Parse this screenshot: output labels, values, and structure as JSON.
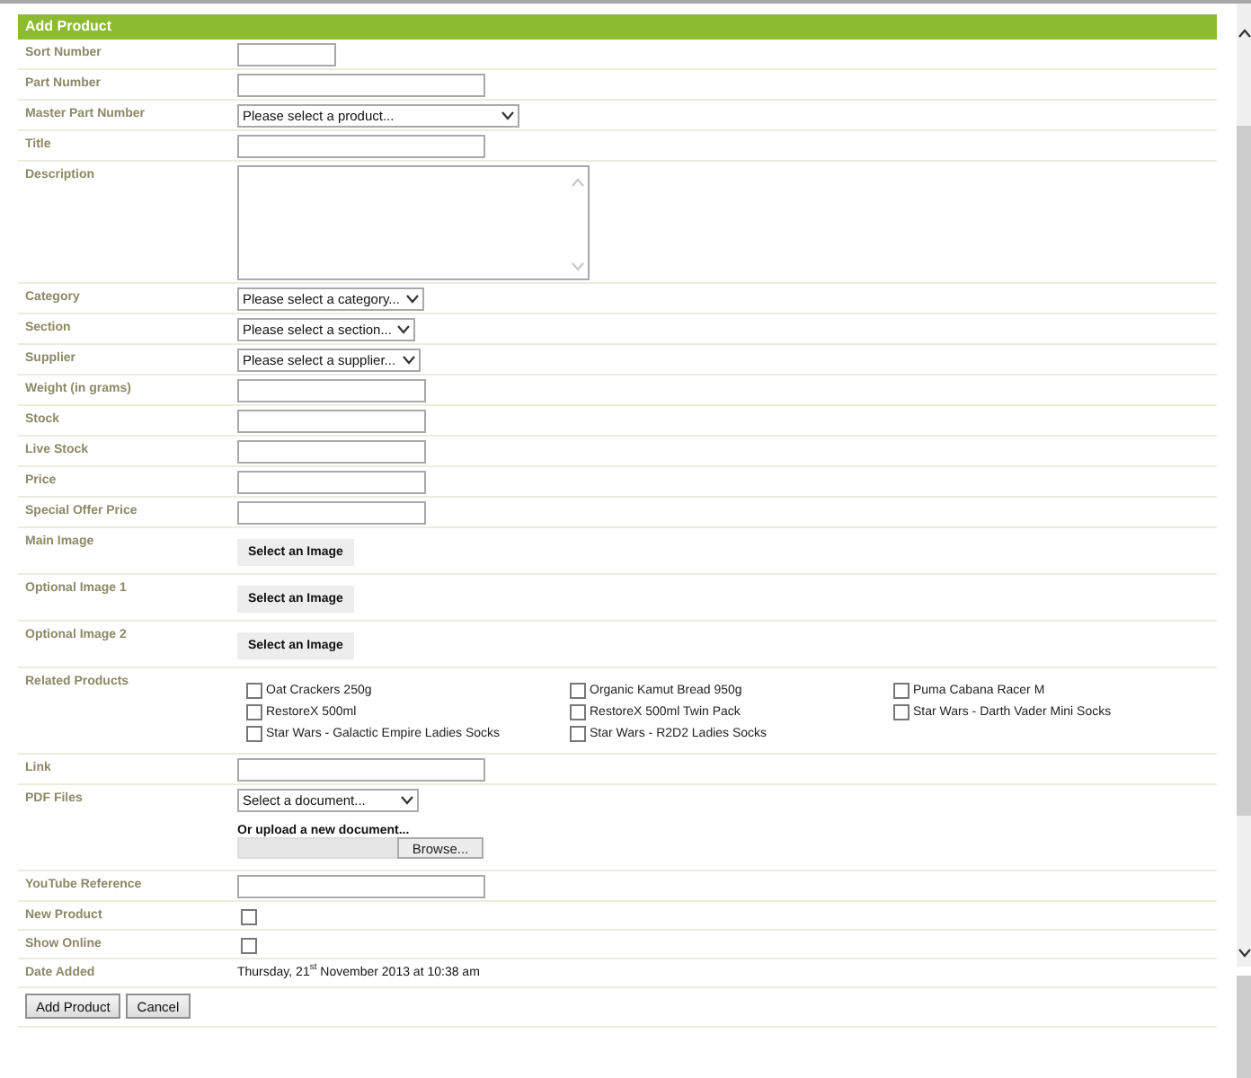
{
  "header": {
    "title": "Add Product"
  },
  "fields": [
    {
      "kind": "text",
      "label": "Sort Number"
    },
    {
      "kind": "text",
      "label": "Part Number"
    },
    {
      "kind": "select",
      "label": "Master Part Number",
      "value": "Please select a product..."
    },
    {
      "kind": "text",
      "label": "Title"
    },
    {
      "kind": "textarea",
      "label": "Description"
    },
    {
      "kind": "select",
      "label": "Category",
      "value": "Please select a category..."
    },
    {
      "kind": "select",
      "label": "Section",
      "value": "Please select a section..."
    },
    {
      "kind": "select",
      "label": "Supplier",
      "value": "Please select a supplier..."
    },
    {
      "kind": "text",
      "label": "Weight (in grams)"
    },
    {
      "kind": "text",
      "label": "Stock"
    },
    {
      "kind": "text",
      "label": "Live Stock"
    },
    {
      "kind": "text",
      "label": "Price"
    },
    {
      "kind": "text",
      "label": "Special Offer Price"
    },
    {
      "kind": "image",
      "label": "Main Image",
      "button": "Select an Image"
    },
    {
      "kind": "image",
      "label": "Optional Image 1",
      "button": "Select an Image"
    },
    {
      "kind": "image",
      "label": "Optional Image 2",
      "button": "Select an Image"
    },
    {
      "kind": "related",
      "label": "Related Products",
      "items": [
        {
          "label": "Oat Crackers 250g",
          "checked": false
        },
        {
          "label": "Organic Kamut Bread 950g",
          "checked": false
        },
        {
          "label": "Puma Cabana Racer M",
          "checked": false
        },
        {
          "label": "RestoreX 500ml",
          "checked": false
        },
        {
          "label": "RestoreX 500ml Twin Pack",
          "checked": false
        },
        {
          "label": "Star Wars - Darth Vader Mini Socks",
          "checked": false
        },
        {
          "label": "Star Wars - Galactic Empire Ladies Socks",
          "checked": false
        },
        {
          "label": "Star Wars - R2D2 Ladies Socks",
          "checked": false
        }
      ]
    },
    {
      "kind": "text",
      "label": "Link"
    },
    {
      "kind": "pdf",
      "label": "PDF Files",
      "value": "Select a document...",
      "upload_label": "Or upload a new document...",
      "browse": "Browse..."
    },
    {
      "kind": "text",
      "label": "YouTube Reference"
    },
    {
      "kind": "checkbox",
      "label": "New Product",
      "checked": false
    },
    {
      "kind": "checkbox",
      "label": "Show Online",
      "checked": false
    },
    {
      "kind": "date",
      "label": "Date Added",
      "value": "Thursday, 21$^{st}$ November 2013 at 10:38 am"
    }
  ],
  "buttons": [
    "Add Product",
    "Cancel"
  ]
}
